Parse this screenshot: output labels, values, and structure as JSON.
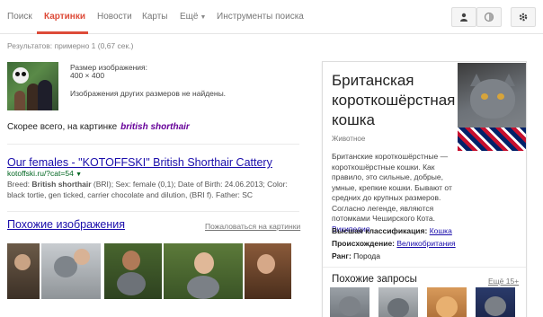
{
  "nav": {
    "tabs": [
      {
        "label": "Поиск"
      },
      {
        "label": "Картинки"
      },
      {
        "label": "Новости"
      },
      {
        "label": "Карты"
      },
      {
        "label": "Ещё"
      },
      {
        "label": "Инструменты поиска"
      }
    ],
    "active_tab": "Картинки",
    "icons": {
      "account": "person-icon",
      "safesearch": "globe-icon",
      "settings": "gear-icon"
    },
    "accent_color": "#dd4b39"
  },
  "results_count": "Результатов: примерно 1 (0,67 сек.)",
  "image_info": {
    "size_label": "Размер изображения:",
    "size_value": "400 × 400",
    "no_other_sizes": "Изображения других размеров не найдены."
  },
  "best_guess": {
    "label": "Скорее всего, на картинке",
    "query": "british shorthair"
  },
  "result": {
    "title": "Our females - \"KOTOFFSKI\" British Shorthair Cattery",
    "url": "kotoffski.ru/?cat=54",
    "snippet_breed_label": "Breed:",
    "snippet_breed_value": "British shorthair",
    "snippet_rest": "(BRI); Sex: female (0,1); Date of Birth: 24.06.2013; Color: black tortie, gen ticked, carrier chocolate and dilution, (BRI f). Father: SC"
  },
  "similar": {
    "header": "Похожие изображения",
    "report": "Пожаловаться на картинки"
  },
  "knowledge_panel": {
    "title": "Британская короткошёрстная кошка",
    "subtitle": "Животное",
    "description": "Британские короткошёрстные — короткошёрстные кошки. Как правило, это сильные, добрые, умные, крепкие кошки. Бывают от средних до крупных размеров. Согласно легенде, являются потомками Чеширского Кота.",
    "source": "Википедия",
    "facts": [
      {
        "label": "Высшая классификация:",
        "value": "Кошка"
      },
      {
        "label": "Происхождение:",
        "value": "Великобритания"
      },
      {
        "label": "Ранг:",
        "value": "Порода"
      }
    ],
    "related_header": "Похожие запросы",
    "related_more": "Ещё 15+"
  },
  "colors": {
    "link": "#1a0dab",
    "url_green": "#006621",
    "visited": "#660099"
  }
}
